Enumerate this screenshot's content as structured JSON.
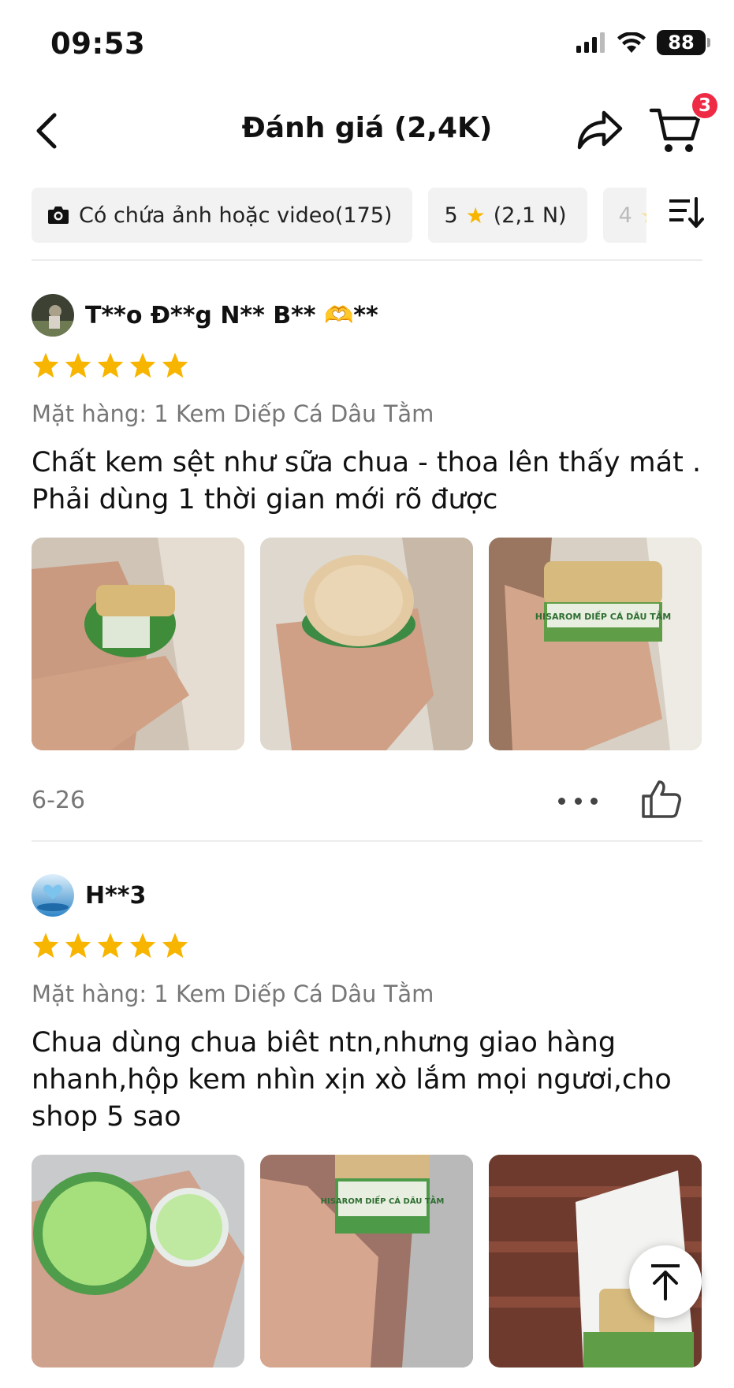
{
  "status_bar": {
    "time": "09:53",
    "battery": "88"
  },
  "header": {
    "title": "Đánh giá (2,4K)",
    "cart_count": "3"
  },
  "filters": [
    {
      "label": "Có chứa ảnh hoặc video",
      "count": "(175)"
    },
    {
      "label": "5",
      "count": "(2,1 N)"
    },
    {
      "label": "4",
      "count": ""
    }
  ],
  "reviews": [
    {
      "username": "T**o Đ**g N** B** 🫶**",
      "rating": 5,
      "variant": "Mặt hàng: 1 Kem Diếp Cá Dâu Tằm",
      "text": "Chất kem sệt như sữa chua - thoa lên thấy mát . Phải dùng 1 thời gian mới rõ được",
      "date": "6-26",
      "photo_labels": [
        "",
        "",
        "HISAROM DIẾP CÁ DÂU TẰM"
      ]
    },
    {
      "username": "H**3",
      "rating": 5,
      "variant": "Mặt hàng: 1 Kem Diếp Cá Dâu Tằm",
      "text": "Chua dùng chua biêt ntn,nhưng giao hàng nhanh,hộp kem nhìn xịn xò lắm mọi ngươi,cho shop 5 sao",
      "date": "",
      "photo_labels": [
        "",
        "HISAROM DIẾP CÁ DÂU TẰM",
        ""
      ]
    }
  ],
  "colors": {
    "star": "#f7b500",
    "badge": "#ee2a45",
    "muted": "#777777"
  },
  "icons": [
    "back-arrow-icon",
    "share-icon",
    "cart-icon",
    "camera-icon",
    "sort-icon",
    "more-dots-icon",
    "thumbs-up-icon",
    "arrow-up-icon"
  ]
}
